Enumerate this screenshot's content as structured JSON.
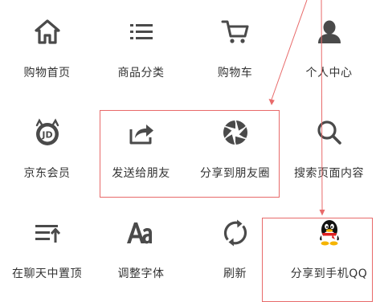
{
  "menu": {
    "items": [
      {
        "label": "购物首页",
        "icon": "home-icon"
      },
      {
        "label": "商品分类",
        "icon": "list-icon"
      },
      {
        "label": "购物车",
        "icon": "cart-icon"
      },
      {
        "label": "个人中心",
        "icon": "user-icon"
      },
      {
        "label": "京东会员",
        "icon": "jd-member-icon"
      },
      {
        "label": "发送给朋友",
        "icon": "share-icon"
      },
      {
        "label": "分享到朋友圈",
        "icon": "moments-icon"
      },
      {
        "label": "搜索页面内容",
        "icon": "search-icon"
      },
      {
        "label": "在聊天中置顶",
        "icon": "pin-top-icon"
      },
      {
        "label": "调整字体",
        "icon": "font-icon"
      },
      {
        "label": "刷新",
        "icon": "refresh-icon"
      },
      {
        "label": "分享到手机QQ",
        "icon": "qq-icon"
      }
    ]
  },
  "colors": {
    "icon": "#4a4a4a",
    "text": "#333333",
    "annotation": "#e86a6a"
  }
}
